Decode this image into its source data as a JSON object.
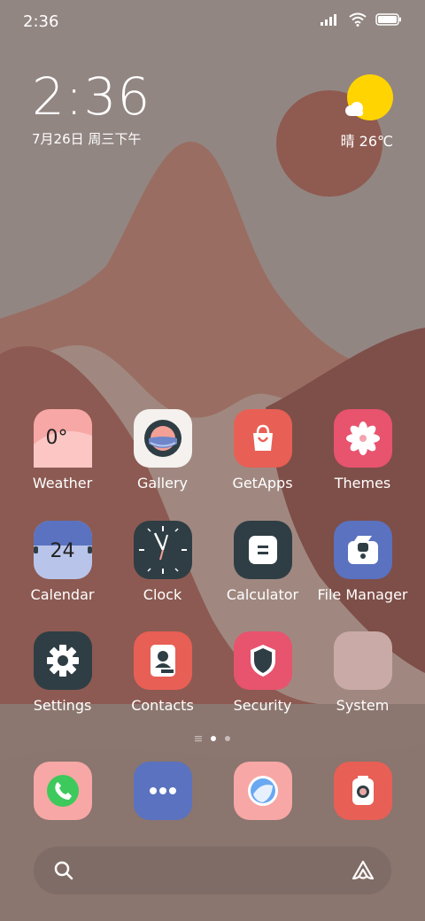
{
  "status_bar": {
    "time": "2:36",
    "icons": [
      "signal-icon",
      "wifi-icon",
      "battery-icon"
    ]
  },
  "clock_widget": {
    "time": "2:36",
    "date": "7月26日 周三下午"
  },
  "weather_widget": {
    "condition_temp": "晴 26℃",
    "icon": "sunny-cloud-icon"
  },
  "apps": [
    {
      "label": "Weather",
      "icon": "weather-icon",
      "icon_text": "0°",
      "color": "#f7a7a5"
    },
    {
      "label": "Gallery",
      "icon": "gallery-icon",
      "color": "#f4f1ee"
    },
    {
      "label": "GetApps",
      "icon": "shopping-bag-icon",
      "color": "#e85f55"
    },
    {
      "label": "Themes",
      "icon": "flower-icon",
      "color": "#e8536e"
    },
    {
      "label": "Calendar",
      "icon": "calendar-icon",
      "icon_text": "24",
      "color": "#5a72bf"
    },
    {
      "label": "Clock",
      "icon": "clock-icon",
      "color": "#2f3e44"
    },
    {
      "label": "Calculator",
      "icon": "calculator-icon",
      "color": "#2f3e44"
    },
    {
      "label": "File Manager",
      "icon": "folder-icon",
      "color": "#5a72bf"
    },
    {
      "label": "Settings",
      "icon": "gear-icon",
      "color": "#2f3e44"
    },
    {
      "label": "Contacts",
      "icon": "contacts-icon",
      "color": "#e85f55"
    },
    {
      "label": "Security",
      "icon": "shield-icon",
      "color": "#e8536e"
    },
    {
      "label": "System",
      "icon": "folder-system-icon",
      "color": "#c9aaa6"
    }
  ],
  "page_indicator": {
    "pages": 2,
    "current": 1
  },
  "dock": [
    {
      "icon": "phone-icon",
      "color": "#f7a7a5"
    },
    {
      "icon": "messages-icon",
      "color": "#5a72bf"
    },
    {
      "icon": "browser-icon",
      "color": "#f7a7a5"
    },
    {
      "icon": "camera-icon",
      "color": "#e85f55"
    }
  ],
  "search_bar": {
    "left_icon": "search-icon",
    "right_icon": "assistant-icon"
  }
}
